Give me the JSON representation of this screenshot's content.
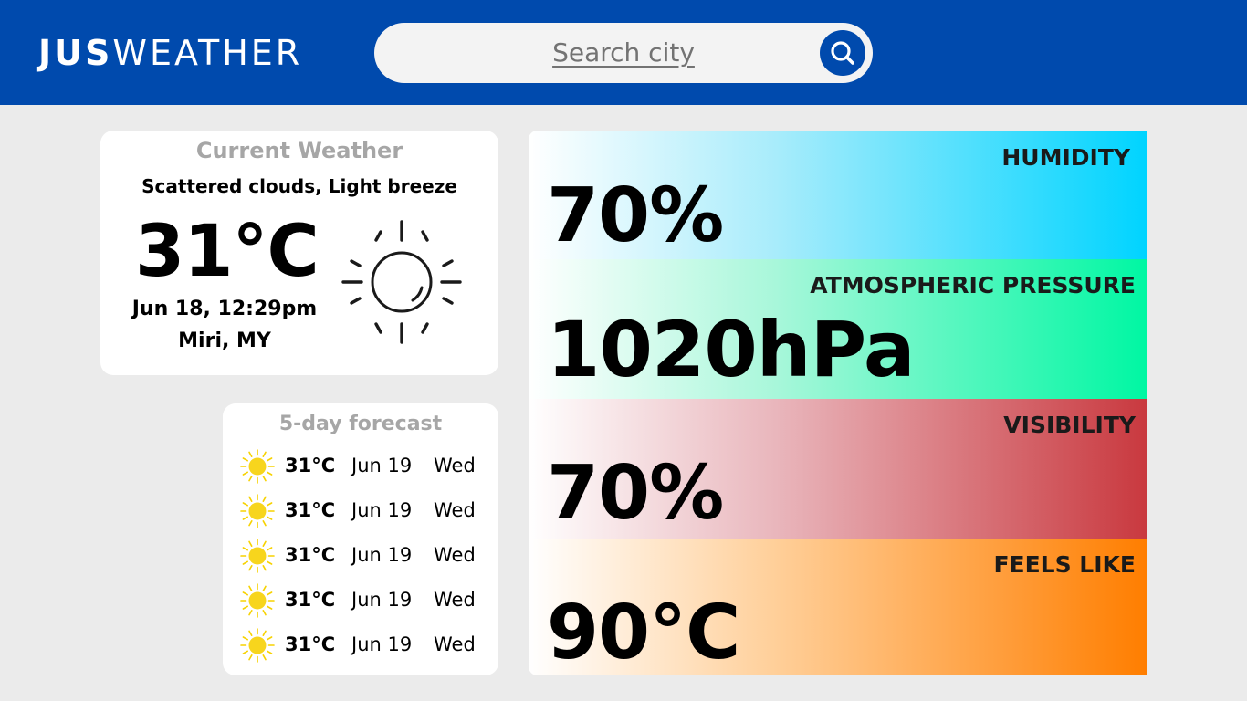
{
  "header": {
    "logo_bold": "JUS",
    "logo_light": "WEATHER",
    "search_placeholder": "Search city",
    "background_color": "#004aad"
  },
  "current": {
    "title": "Current Weather",
    "description": "Scattered clouds, Light breeze",
    "temperature": "31°C",
    "datetime": "Jun 18, 12:29pm",
    "location": "Miri, MY",
    "icon": "sun-outline-icon"
  },
  "forecast": {
    "title": "5-day forecast",
    "days": [
      {
        "temp": "31°C",
        "date": "Jun 19",
        "weekday": "Wed",
        "icon": "sun-icon"
      },
      {
        "temp": "31°C",
        "date": "Jun 19",
        "weekday": "Wed",
        "icon": "sun-icon"
      },
      {
        "temp": "31°C",
        "date": "Jun 19",
        "weekday": "Wed",
        "icon": "sun-icon"
      },
      {
        "temp": "31°C",
        "date": "Jun 19",
        "weekday": "Wed",
        "icon": "sun-icon"
      },
      {
        "temp": "31°C",
        "date": "Jun 19",
        "weekday": "Wed",
        "icon": "sun-icon"
      }
    ]
  },
  "stats": {
    "humidity": {
      "label": "HUMIDITY",
      "value": "70%",
      "color": "#00d4ff"
    },
    "pressure": {
      "label": "ATMOSPHERIC PRESSURE",
      "value": "1020hPa",
      "color": "#00f7a3"
    },
    "visibility": {
      "label": "VISIBILITY",
      "value": "70%",
      "color": "#c9393f"
    },
    "feels_like": {
      "label": "FEELS LIKE",
      "value": "90°C",
      "color": "#ff7e00"
    }
  }
}
